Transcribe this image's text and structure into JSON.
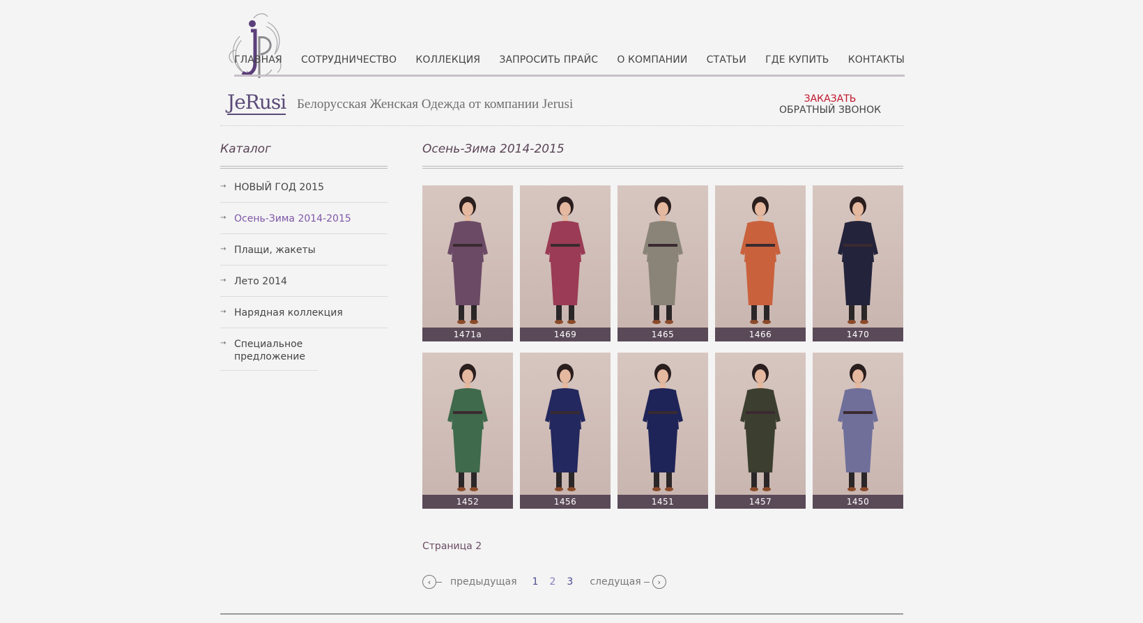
{
  "nav": {
    "items": [
      "ГЛАВНАЯ",
      "СОТРУДНИЧЕСТВО",
      "КОЛЛЕКЦИЯ",
      "ЗАПРОСИТЬ ПРАЙС",
      "О КОМПАНИИ",
      "СТАТЬИ",
      "ГДЕ КУПИТЬ",
      "КОНТАКТЫ"
    ]
  },
  "brand": {
    "logo": "JeRusi",
    "tagline": "Белорусская Женская Одежда от компании Jerusi"
  },
  "callback": {
    "order": "ЗАКАЗАТЬ",
    "label": "ОБРАТНЫЙ ЗВОНОК"
  },
  "sidebar": {
    "title": "Каталог",
    "items": [
      {
        "label": "НОВЫЙ ГОД 2015"
      },
      {
        "label": "Осень-Зима 2014-2015"
      },
      {
        "label": "Плащи, жакеты"
      },
      {
        "label": "Лето 2014"
      },
      {
        "label": "Нарядная коллекция"
      },
      {
        "label": "Специальное предложение"
      }
    ]
  },
  "main": {
    "title": "Осень-Зима 2014-2015",
    "products": [
      {
        "code": "1471а",
        "color": "#6b4a66"
      },
      {
        "code": "1469",
        "color": "#9b3b55"
      },
      {
        "code": "1465",
        "color": "#8a8478"
      },
      {
        "code": "1466",
        "color": "#c9613d"
      },
      {
        "code": "1470",
        "color": "#23233b"
      },
      {
        "code": "1452",
        "color": "#3f6a4c"
      },
      {
        "code": "1456",
        "color": "#23285e"
      },
      {
        "code": "1451",
        "color": "#1f2458"
      },
      {
        "code": "1457",
        "color": "#3c3f30"
      },
      {
        "code": "1450",
        "color": "#6f6f9a"
      }
    ],
    "page_label": "Страница 2"
  },
  "pager": {
    "prev": "предыдущая",
    "next": "следущая",
    "pages": [
      "1",
      "2",
      "3"
    ]
  }
}
